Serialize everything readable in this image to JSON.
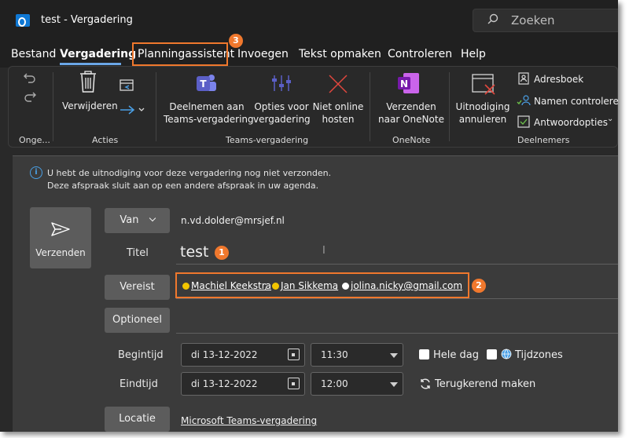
{
  "window": {
    "app_icon": "outlook-icon",
    "title": "test - Vergadering"
  },
  "search": {
    "placeholder": "Zoeken"
  },
  "menu": {
    "items": [
      "Bestand",
      "Vergadering",
      "Planningassistent",
      "Invoegen",
      "Tekst opmaken",
      "Controleren",
      "Help"
    ],
    "active": "Vergadering",
    "callout_planning": "3"
  },
  "ribbon": {
    "undo_group_label": "Onge...",
    "delete_label": "Verwijderen",
    "acties_label": "Acties",
    "teams_join_line1": "Deelnemen aan",
    "teams_join_line2": "Teams-vergadering",
    "options_line1": "Opties voor",
    "options_line2": "vergadering",
    "not_online_line1": "Niet online",
    "not_online_line2": "hosten",
    "teams_group_label": "Teams-vergadering",
    "onenote_line1": "Verzenden",
    "onenote_line2": "naar OneNote",
    "onenote_group_label": "OneNote",
    "cancel_line1": "Uitnodiging",
    "cancel_line2": "annuleren",
    "address_book": "Adresboek",
    "check_names": "Namen controleren",
    "response_options": "Antwoordopties",
    "attendees_group_label": "Deelnemers"
  },
  "info": {
    "line1": "U hebt de uitnodiging voor deze vergadering nog niet verzonden.",
    "line2": "Deze afspraak sluit aan op een andere afspraak in uw agenda."
  },
  "form": {
    "send_label": "Verzenden",
    "from_button": "Van",
    "from_value": "n.vd.dolder@mrsjef.nl",
    "title_label": "Titel",
    "title_value": "test",
    "title_callout": "1",
    "required_button": "Vereist",
    "required_callout": "2",
    "attendees": [
      {
        "name": "Machiel Keekstra",
        "status": "yellow"
      },
      {
        "name": "Jan Sikkema",
        "status": "yellow"
      },
      {
        "name": "jolina.nicky@gmail.com",
        "status": "white"
      }
    ],
    "attendee_separator": ";",
    "optional_button": "Optioneel",
    "start_label": "Begintijd",
    "start_date": "di 13-12-2022",
    "start_time": "11:30",
    "allday_label": "Hele dag",
    "timezones_label": "Tijdzones",
    "end_label": "Eindtijd",
    "end_date": "di 13-12-2022",
    "end_time": "12:00",
    "recurring_label": "Terugkerend maken",
    "location_button": "Locatie",
    "location_value": "Microsoft Teams-vergadering"
  },
  "colors": {
    "accent_orange": "#f0782d",
    "presence_yellow": "#f2c500",
    "teams_purple": "#5b5fc7",
    "delete_red": "#e0473e",
    "onenote_purple": "#7719aa",
    "outlook_blue": "#0f78d4"
  }
}
